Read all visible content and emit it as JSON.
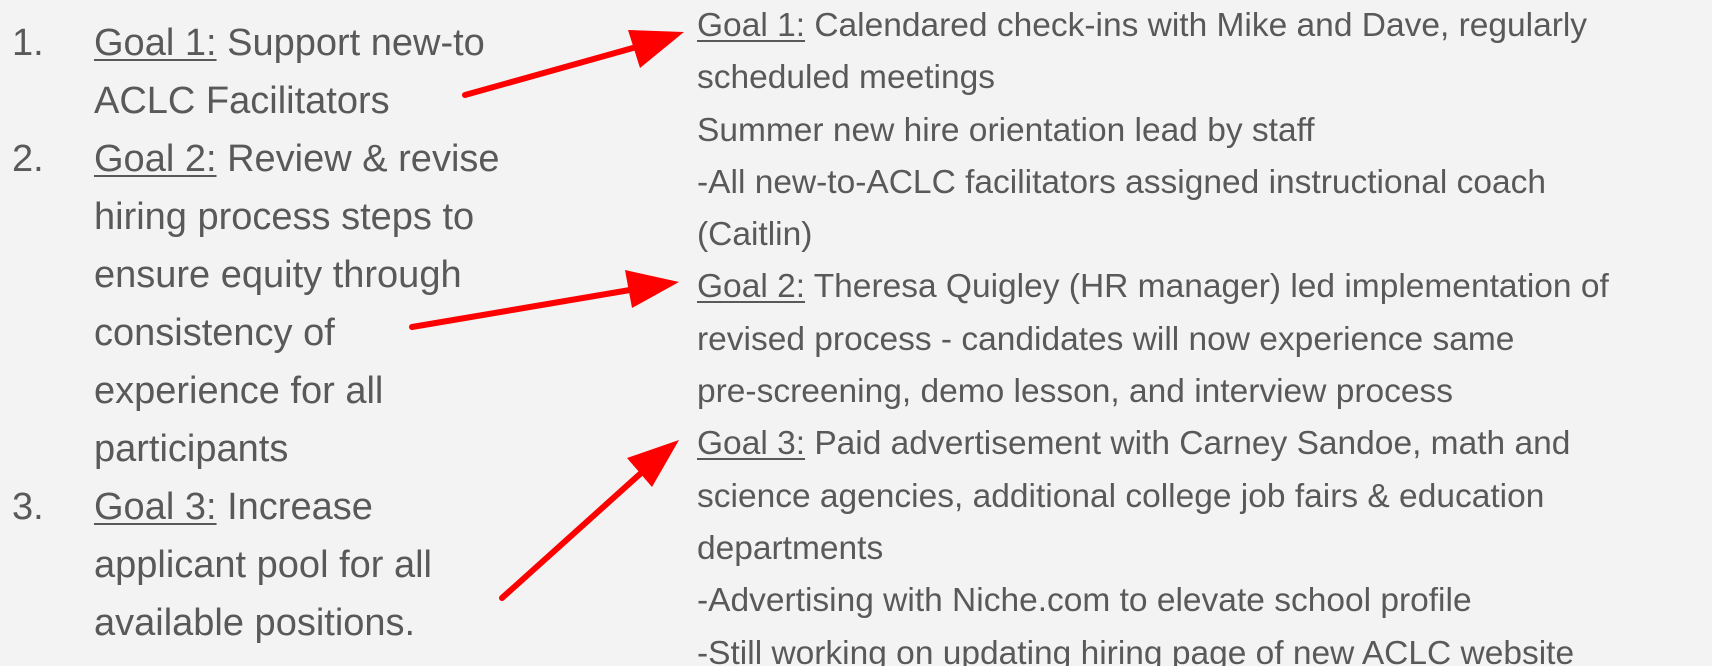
{
  "goals": [
    {
      "number": "1.",
      "label": "Goal 1:",
      "text_lines": [
        "Support new-to",
        "ACLC Facilitators"
      ]
    },
    {
      "number": "2.",
      "label": "Goal 2:",
      "text_lines": [
        "Review & revise",
        "hiring process steps to",
        "ensure equity through",
        "consistency of",
        "experience for all",
        "participants"
      ]
    },
    {
      "number": "3.",
      "label": "Goal 3:",
      "text_lines": [
        "Increase",
        "applicant pool for all",
        "available positions."
      ]
    }
  ],
  "outcomes": {
    "line_1": {
      "label": "Goal 1:",
      "text": " Calendared check-ins with Mike and Dave, regularly"
    },
    "line_2": "scheduled meetings",
    "line_3": "Summer new hire orientation lead by staff",
    "line_4": "-All new-to-ACLC facilitators assigned instructional coach",
    "line_5": "(Caitlin)",
    "line_6": {
      "label": "Goal 2:",
      "text": " Theresa Quigley (HR manager) led implementation of"
    },
    "line_7": "revised process - candidates will now experience same",
    "line_8": "pre-screening, demo lesson, and interview process",
    "line_9": {
      "label": "Goal 3:",
      "text": " Paid advertisement with Carney Sandoe, math and"
    },
    "line_10": "science agencies, additional college job fairs & education",
    "line_11": "departments",
    "line_12": "-Advertising with Niche.com to elevate school profile",
    "line_13": "-Still working on updating hiring page of new ACLC website"
  },
  "colors": {
    "text": "#595959",
    "arrow": "#ff0000",
    "background": "#f3f3f3"
  }
}
